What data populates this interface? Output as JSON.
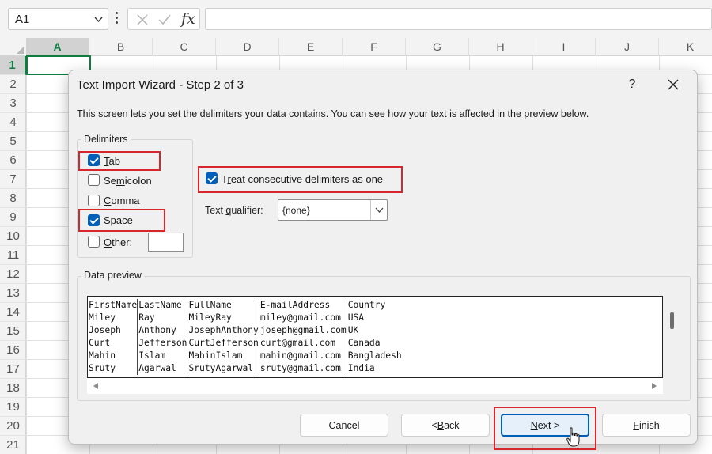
{
  "formula_bar": {
    "name_box": "A1",
    "icons": [
      "chevron-down-icon",
      "more-vertical-icon",
      "cancel-x-icon",
      "enter-check-icon"
    ],
    "fx_label": "fx",
    "formula": ""
  },
  "grid": {
    "columns": [
      "A",
      "B",
      "C",
      "D",
      "E",
      "F",
      "G",
      "H",
      "I",
      "J",
      "K"
    ],
    "rows": [
      "1",
      "2",
      "3",
      "4",
      "5",
      "6",
      "7",
      "8",
      "9",
      "10",
      "11",
      "12",
      "13",
      "14",
      "15",
      "16",
      "17",
      "18",
      "19",
      "20",
      "21"
    ],
    "selected_cell": "A1"
  },
  "dialog": {
    "title": "Text Import Wizard - Step 2 of 3",
    "help": "?",
    "description": "This screen lets you set the delimiters your data contains.  You can see how your text is affected in the preview below.",
    "delimiters": {
      "group_title": "Delimiters",
      "tab": {
        "u": "T",
        "rest": "ab",
        "checked": true
      },
      "semicolon": {
        "pre": "Se",
        "u": "m",
        "rest": "icolon",
        "checked": false
      },
      "comma": {
        "u": "C",
        "rest": "omma",
        "checked": false
      },
      "space": {
        "u": "S",
        "rest": "pace",
        "checked": true
      },
      "other": {
        "u": "O",
        "rest": "ther:",
        "checked": false,
        "value": ""
      }
    },
    "consecutive": {
      "pre": "T",
      "u": "r",
      "rest": "eat consecutive delimiters as one",
      "checked": true
    },
    "text_qualifier": {
      "pre": "Text ",
      "u": "q",
      "rest": "ualifier:",
      "value": "{none}"
    },
    "preview": {
      "title": "Data preview",
      "rows": [
        [
          "FirstName",
          "LastName",
          "FullName",
          "E-mailAddress",
          "Country"
        ],
        [
          "Miley",
          "Ray",
          "MileyRay",
          "miley@gmail.com",
          "USA"
        ],
        [
          "Joseph",
          "Anthony",
          "JosephAnthony",
          "joseph@gmail.com",
          "UK"
        ],
        [
          "Curt",
          "Jefferson",
          "CurtJefferson",
          "curt@gmail.com",
          "Canada"
        ],
        [
          "Mahin",
          "Islam",
          "MahinIslam",
          "mahin@gmail.com",
          "Bangladesh"
        ],
        [
          "Sruty",
          "Agarwal",
          "SrutyAgarwal",
          "sruty@gmail.com",
          "India"
        ]
      ]
    },
    "buttons": {
      "cancel": "Cancel",
      "back": {
        "pre": "< ",
        "u": "B",
        "rest": "ack"
      },
      "next": {
        "u": "N",
        "rest": "ext >"
      },
      "finish": {
        "u": "F",
        "rest": "inish"
      }
    },
    "highlight_color": "#d7262c",
    "accent_color": "#005fb8"
  }
}
